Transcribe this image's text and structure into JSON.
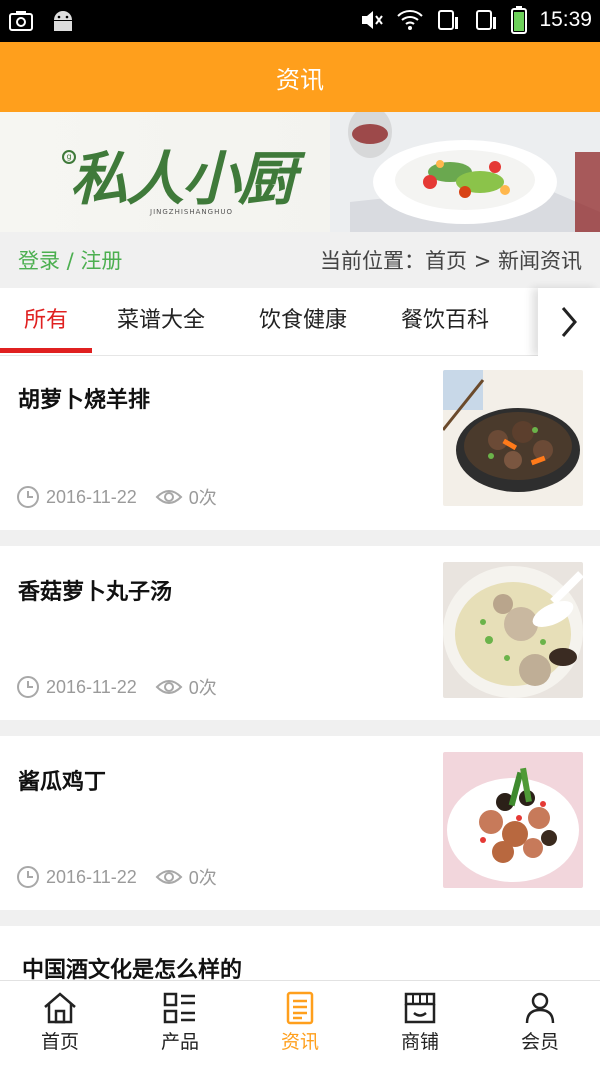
{
  "status_bar": {
    "time": "15:39"
  },
  "header": {
    "title": "资讯"
  },
  "banner": {
    "logo_text": "私人小厨",
    "logo_sub": "JINGZHISHANGHUO",
    "logo_mark": "g"
  },
  "location_bar": {
    "login_text": "登录 / 注册",
    "breadcrumb": "当前位置：首页 > 新闻资讯"
  },
  "tabs": [
    {
      "label": "所有",
      "active": true
    },
    {
      "label": "菜谱大全",
      "active": false
    },
    {
      "label": "饮食健康",
      "active": false
    },
    {
      "label": "餐饮百科",
      "active": false
    }
  ],
  "articles": [
    {
      "title": "胡萝卜烧羊排",
      "date": "2016-11-22",
      "views": "0次",
      "thumb_icon": "lamb-stew-photo"
    },
    {
      "title": "香菇萝卜丸子汤",
      "date": "2016-11-22",
      "views": "0次",
      "thumb_icon": "meatball-soup-photo"
    },
    {
      "title": "酱瓜鸡丁",
      "date": "2016-11-22",
      "views": "0次",
      "thumb_icon": "diced-chicken-photo"
    },
    {
      "title": "中国酒文化是怎么样的"
    }
  ],
  "bottom_nav": [
    {
      "label": "首页",
      "icon": "home-icon",
      "active": false
    },
    {
      "label": "产品",
      "icon": "grid-list-icon",
      "active": false
    },
    {
      "label": "资讯",
      "icon": "document-icon",
      "active": true
    },
    {
      "label": "商铺",
      "icon": "store-icon",
      "active": false
    },
    {
      "label": "会员",
      "icon": "user-icon",
      "active": false
    }
  ],
  "colors": {
    "accent": "#ff9f1c",
    "tab_active": "#e02020",
    "login_green": "#4caf50"
  }
}
